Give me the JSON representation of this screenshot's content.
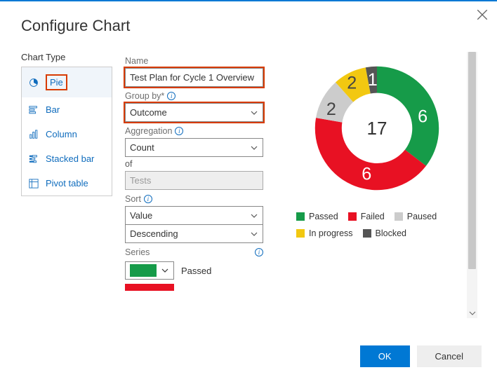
{
  "dialog": {
    "title": "Configure Chart",
    "ok_label": "OK",
    "cancel_label": "Cancel"
  },
  "chart_type": {
    "section_label": "Chart Type",
    "items": [
      {
        "key": "pie",
        "label": "Pie",
        "selected": true
      },
      {
        "key": "bar",
        "label": "Bar",
        "selected": false
      },
      {
        "key": "column",
        "label": "Column",
        "selected": false
      },
      {
        "key": "stacked_bar",
        "label": "Stacked bar",
        "selected": false
      },
      {
        "key": "pivot_table",
        "label": "Pivot table",
        "selected": false
      }
    ]
  },
  "form": {
    "name_label": "Name",
    "name_value": "Test Plan for Cycle 1 Overview",
    "groupby_label": "Group by*",
    "groupby_value": "Outcome",
    "aggregation_label": "Aggregation",
    "aggregation_value": "Count",
    "of_label": "of",
    "of_value": "Tests",
    "sort_label": "Sort",
    "sort_field": "Value",
    "sort_dir": "Descending",
    "series_label": "Series",
    "series": [
      {
        "label": "Passed",
        "color": "#169b49"
      }
    ],
    "series_partial_color": "#e81123"
  },
  "colors": {
    "passed": "#169b49",
    "failed": "#e81123",
    "paused": "#cccccc",
    "inprogress": "#f2c811",
    "blocked": "#555555",
    "accent": "#0078d4",
    "highlight": "#d83b01"
  },
  "chart_data": {
    "type": "pie",
    "style": "donut",
    "total": 17,
    "categories": [
      "Passed",
      "Failed",
      "Paused",
      "In progress",
      "Blocked"
    ],
    "values": [
      6,
      6,
      2,
      2,
      1
    ],
    "colors": [
      "#169b49",
      "#e81123",
      "#cccccc",
      "#f2c811",
      "#555555"
    ],
    "legend_position": "bottom",
    "center_label": "17"
  }
}
